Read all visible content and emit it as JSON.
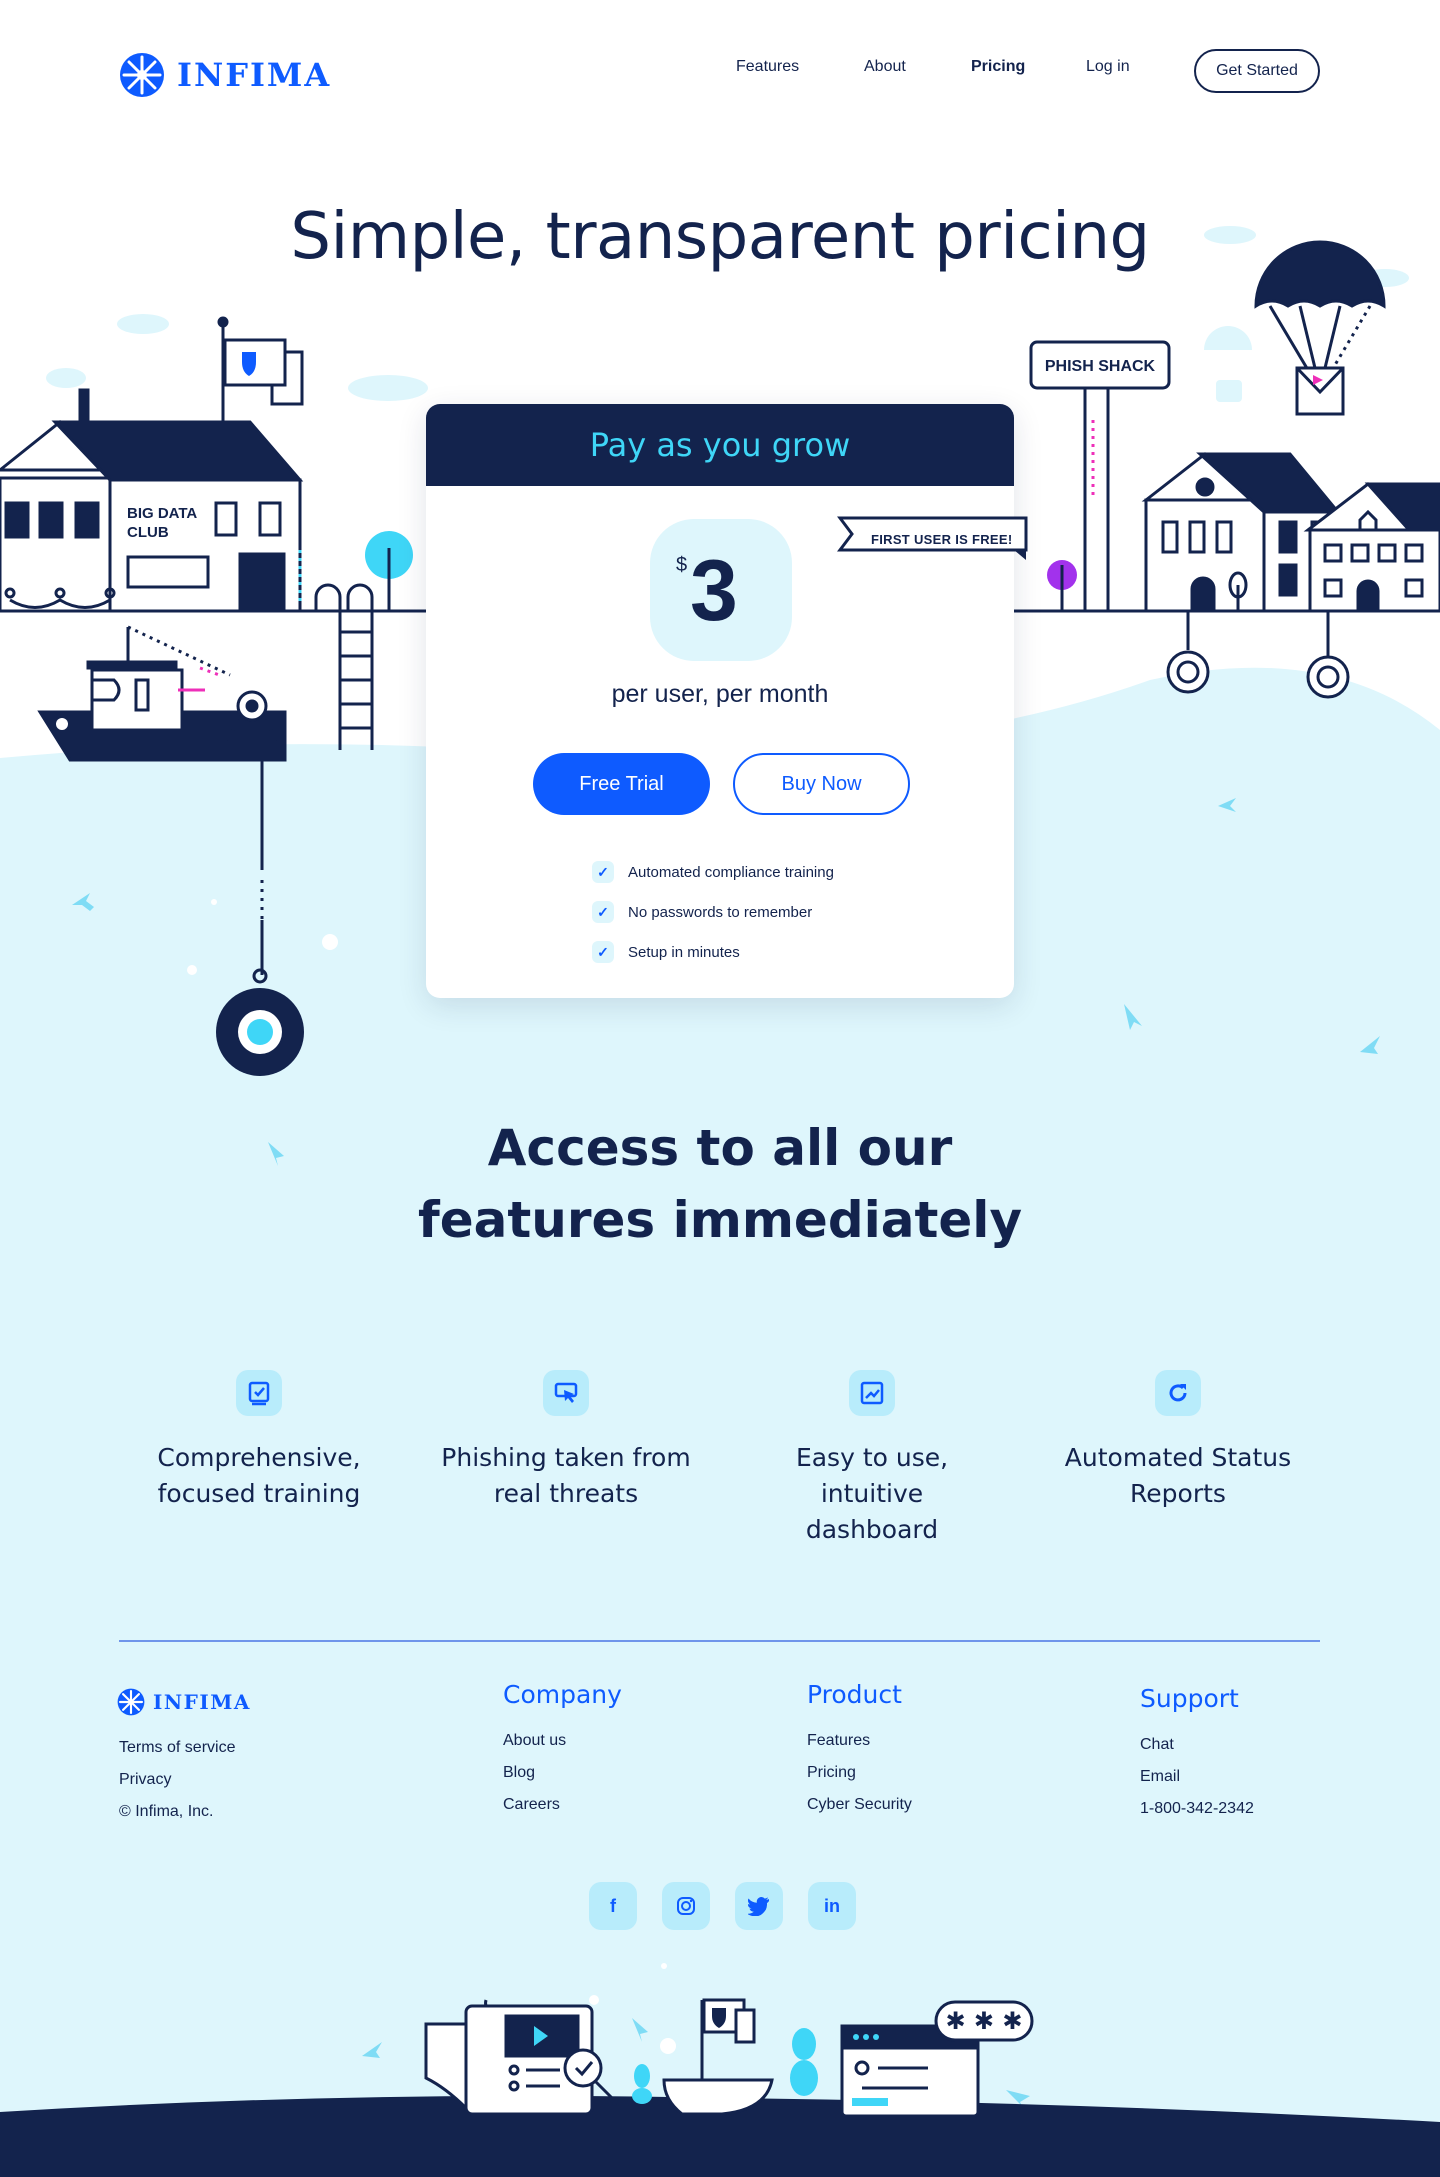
{
  "brand": {
    "name": "INFIMA",
    "primary": "#0e5bff",
    "navy": "#13234d",
    "cyan": "#3fd6f7",
    "water": "#def6fc"
  },
  "nav": {
    "links": [
      "Features",
      "About",
      "Pricing",
      "Log in"
    ],
    "active": "Pricing",
    "cta": "Get Started"
  },
  "hero": {
    "title": "Simple, transparent pricing"
  },
  "scene": {
    "club_sign": [
      "BIG DATA",
      "CLUB"
    ],
    "shop_sign": "PHISH SHACK"
  },
  "pricing": {
    "header": "Pay as you grow",
    "currency": "$",
    "price": "3",
    "unit": "per user, per month",
    "ribbon": "FIRST USER IS FREE!",
    "primary_button": "Free Trial",
    "secondary_button": "Buy Now",
    "features": [
      "Automated compliance training",
      "No passwords to remember",
      "Setup in minutes"
    ]
  },
  "access": {
    "title_line1": "Access to all our",
    "title_line2": "features immediately",
    "features": [
      {
        "icon": "training-icon",
        "line1": "Comprehensive,",
        "line2": "focused training"
      },
      {
        "icon": "phishing-icon",
        "line1": "Phishing taken from",
        "line2": "real threats"
      },
      {
        "icon": "dashboard-icon",
        "line1": "Easy to use, intuitive",
        "line2": "dashboard"
      },
      {
        "icon": "refresh-icon",
        "line1": "Automated Status",
        "line2": "Reports"
      }
    ]
  },
  "footer": {
    "brand": "INFIMA",
    "legal": [
      "Terms of service",
      "Privacy",
      "© Infima, Inc."
    ],
    "columns": [
      {
        "title": "Company",
        "links": [
          "About us",
          "Blog",
          "Careers"
        ]
      },
      {
        "title": "Product",
        "links": [
          "Features",
          "Pricing",
          "Cyber Security"
        ]
      },
      {
        "title": "Support",
        "links": [
          "Chat",
          "Email",
          "1-800-342-2342"
        ]
      }
    ],
    "socials": [
      {
        "icon": "facebook-icon",
        "glyph": "f"
      },
      {
        "icon": "instagram-icon",
        "glyph": "◎"
      },
      {
        "icon": "twitter-icon",
        "glyph": "🐦"
      },
      {
        "icon": "linkedin-icon",
        "glyph": "in"
      }
    ]
  }
}
